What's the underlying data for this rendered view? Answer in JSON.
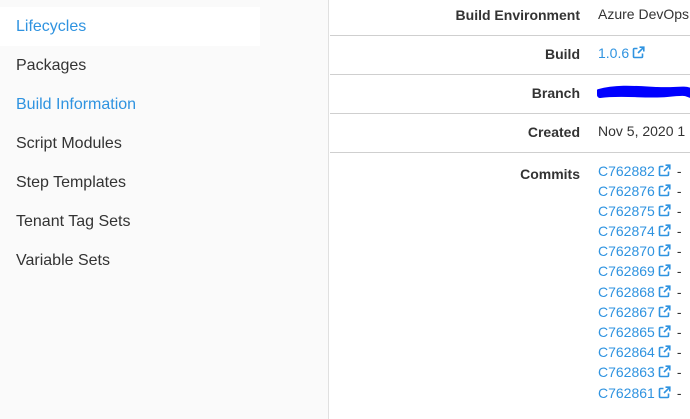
{
  "sidebar": {
    "items": [
      {
        "label": "Lifecycles"
      },
      {
        "label": "Packages"
      },
      {
        "label": "Build Information"
      },
      {
        "label": "Script Modules"
      },
      {
        "label": "Step Templates"
      },
      {
        "label": "Tenant Tag Sets"
      },
      {
        "label": "Variable Sets"
      }
    ]
  },
  "details": {
    "build_environment": {
      "label": "Build Environment",
      "value": "Azure DevOps"
    },
    "build": {
      "label": "Build",
      "value": "1.0.6"
    },
    "branch": {
      "label": "Branch"
    },
    "created": {
      "label": "Created",
      "value": "Nov 5, 2020 1"
    },
    "commits": {
      "label": "Commits",
      "dash": "-",
      "items": [
        "C762882",
        "C762876",
        "C762875",
        "C762874",
        "C762870",
        "C762869",
        "C762868",
        "C762867",
        "C762865",
        "C762864",
        "C762863",
        "C762861"
      ]
    }
  },
  "colors": {
    "accent": "#2f93e0",
    "redaction": "#0000ff"
  },
  "icons": {
    "external_link": "external-link-icon"
  }
}
